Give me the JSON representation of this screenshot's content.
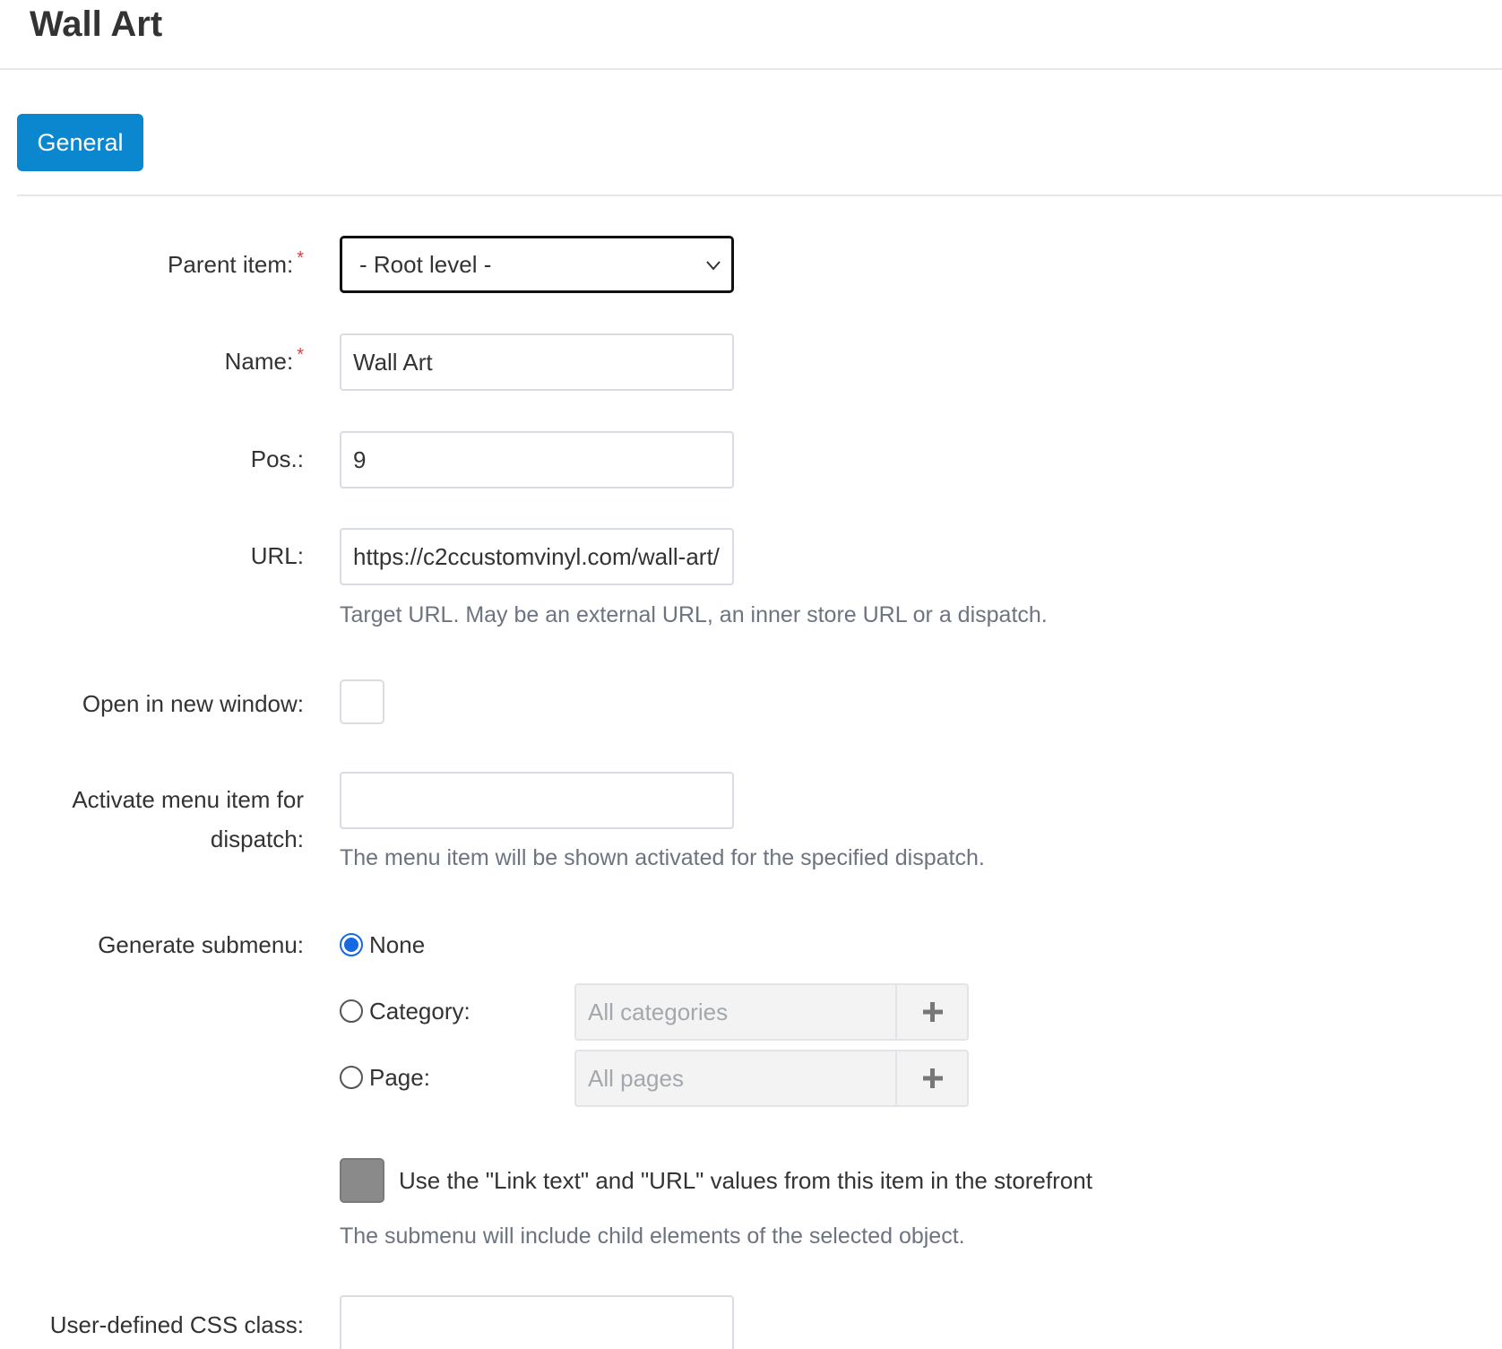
{
  "header": {
    "title": "Wall Art"
  },
  "tabs": [
    {
      "label": "General",
      "active": true
    }
  ],
  "form": {
    "parent_item": {
      "label": "Parent item:",
      "required_mark": "*",
      "value": "- Root level -"
    },
    "name": {
      "label": "Name:",
      "required_mark": "*",
      "value": "Wall Art"
    },
    "pos": {
      "label": "Pos.:",
      "value": "9"
    },
    "url": {
      "label": "URL:",
      "value": "https://c2ccustomvinyl.com/wall-art/",
      "help": "Target URL. May be an external URL, an inner store URL or a dispatch."
    },
    "open_new_window": {
      "label": "Open in new window:",
      "checked": false
    },
    "activate_dispatch": {
      "label_line1": "Activate menu item for",
      "label_line2": "dispatch:",
      "value": "",
      "help": "The menu item will be shown activated for the specified dispatch."
    },
    "generate_submenu": {
      "label": "Generate submenu:",
      "options": [
        {
          "label": "None",
          "checked": true
        },
        {
          "label": "Category:",
          "checked": false,
          "picker_placeholder": "All categories"
        },
        {
          "label": "Page:",
          "checked": false,
          "picker_placeholder": "All pages"
        }
      ],
      "use_link_values": {
        "label": "Use the \"Link text\" and \"URL\" values from this item in the storefront",
        "checked": true
      },
      "help": "The submenu will include child elements of the selected object."
    },
    "css_class": {
      "label": "User-defined CSS class:",
      "value": ""
    }
  },
  "colors": {
    "accent": "#0b87cf",
    "radio_checked": "#1668e3",
    "required": "#e53b3b",
    "help_text": "#6b7480"
  }
}
